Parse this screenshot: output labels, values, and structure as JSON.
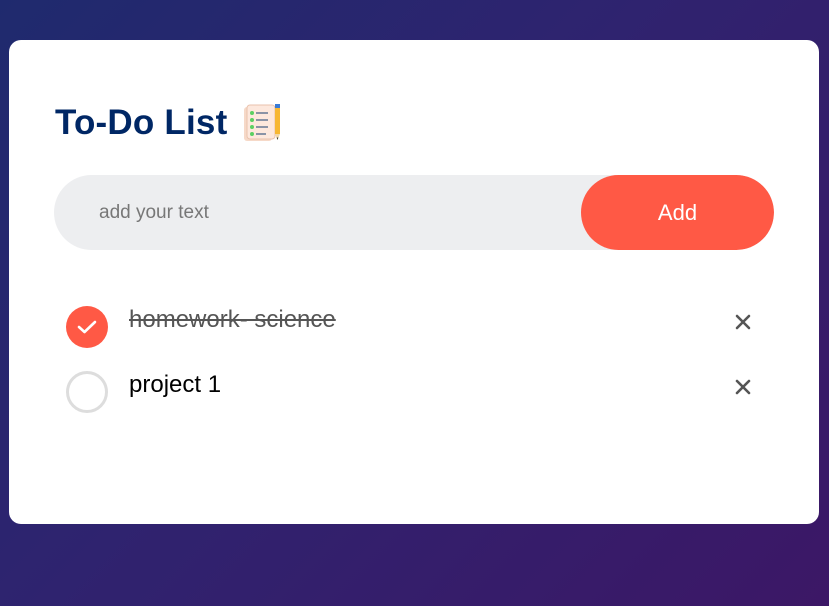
{
  "app": {
    "title": "To-Do List",
    "title_icon": "notepad-pencil-icon"
  },
  "input": {
    "placeholder": "add your text",
    "value": "",
    "add_label": "Add"
  },
  "tasks": [
    {
      "text": "homework- science",
      "done": true
    },
    {
      "text": "project 1",
      "done": false
    }
  ],
  "colors": {
    "accent": "#ff5945",
    "title": "#002765",
    "input_bg": "#edeef0",
    "background_start": "#1f2a6e",
    "background_end": "#3c1766"
  },
  "icons": {
    "check": "check-icon",
    "remove": "close-icon"
  }
}
